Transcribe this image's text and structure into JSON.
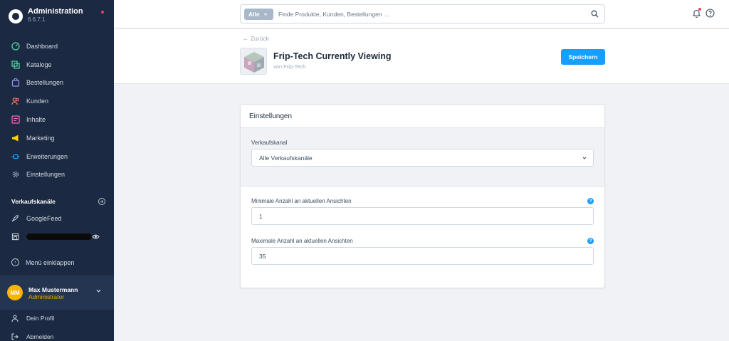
{
  "app": {
    "title": "Administration",
    "version": "6.6.7.1"
  },
  "sidebar": {
    "nav": [
      {
        "label": "Dashboard",
        "icon": "gauge-icon",
        "color": "#57d9a3"
      },
      {
        "label": "Kataloge",
        "icon": "catalog-icon",
        "color": "#57d9a3"
      },
      {
        "label": "Bestellungen",
        "icon": "bag-icon",
        "color": "#a092f0"
      },
      {
        "label": "Kunden",
        "icon": "users-icon",
        "color": "#f88962"
      },
      {
        "label": "Inhalte",
        "icon": "content-icon",
        "color": "#ff68b4"
      },
      {
        "label": "Marketing",
        "icon": "megaphone-icon",
        "color": "#ffd700"
      },
      {
        "label": "Erweiterungen",
        "icon": "plug-icon",
        "color": "#189eff"
      },
      {
        "label": "Einstellungen",
        "icon": "gear-icon",
        "color": "#9aa8b9"
      }
    ],
    "sales_channels_title": "Verkaufskanäle",
    "channels": [
      {
        "label": "GoogleFeed",
        "icon": "rocket-icon"
      },
      {
        "label": "",
        "icon": "storefront-icon",
        "redacted": true
      }
    ],
    "collapse_label": "Menü einklappen",
    "user": {
      "initials": "MM",
      "name": "Max Mustermann",
      "role": "Administrator"
    },
    "profile_label": "Dein Profil",
    "logout_label": "Abmelden"
  },
  "search": {
    "type_label": "Alle",
    "placeholder": "Finde Produkte, Kunden, Bestellungen ..."
  },
  "header": {
    "back_label": "← Zurück",
    "title": "Frip-Tech Currently Viewing",
    "subtitle": "von Frip-Tech",
    "save_label": "Speichern"
  },
  "card": {
    "title": "Einstellungen",
    "sales_channel": {
      "label": "Verkaufskanal",
      "value": "Alle Verkaufskanäle"
    },
    "min_views": {
      "label": "Minimale Anzahl an aktuellen Ansichten",
      "value": "1"
    },
    "max_views": {
      "label": "Maximale Anzahl an aktuellen Ansichten",
      "value": "35"
    }
  },
  "colors": {
    "sidebar_bg": "#1b2a42",
    "accent": "#189eff",
    "role": "#f7a600",
    "avatar": "#f7b500"
  }
}
